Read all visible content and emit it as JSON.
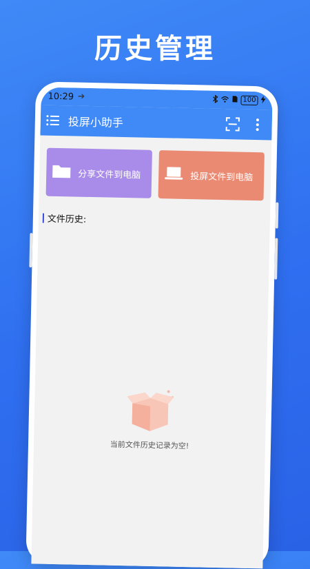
{
  "headline": "历史管理",
  "status": {
    "time": "10:29",
    "battery": "100"
  },
  "appbar": {
    "title": "投屏小助手"
  },
  "cards": {
    "share_label": "分享文件到电脑",
    "cast_label": "投屏文件到电脑"
  },
  "history": {
    "title": "文件历史:",
    "empty_text": "当前文件历史记录为空!"
  },
  "colors": {
    "background": "#2f6ff0",
    "appbar": "#3f8af7",
    "share_card": "#a98be9",
    "cast_card": "#ea8a72"
  }
}
